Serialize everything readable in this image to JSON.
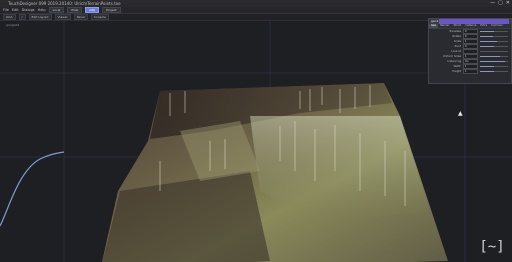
{
  "window": {
    "title": "TouchDesigner 099 2019.20140: Ulrich/TerrainPoints.toe",
    "controls": [
      "—",
      "▢",
      "✕"
    ]
  },
  "menubar": {
    "items": [
      "File",
      "Edit",
      "Dialogs",
      "Help"
    ],
    "buttons": [
      "Local",
      "Pixel",
      "Glbl",
      "Project"
    ],
    "active_button": "Glbl"
  },
  "toolbar2": {
    "items": [
      "OCA",
      "/",
      "Edit Layout",
      "Viewer",
      "Panel",
      "Console"
    ]
  },
  "viewport": {
    "label": "/project1"
  },
  "param_panel": {
    "title": "geo1",
    "tabs": [
      "Geo",
      "Render",
      "Xform",
      "Instance",
      "Extra",
      "Common"
    ],
    "active_tab": "Geo",
    "rows": [
      {
        "label": "Translate",
        "value": "0",
        "fill": 0.5
      },
      {
        "label": "Rotate",
        "value": "0",
        "fill": 0.45
      },
      {
        "label": "Scale",
        "value": "1",
        "fill": 0.6
      },
      {
        "label": "Pivot",
        "value": "0",
        "fill": 0.5
      },
      {
        "label": "Look At",
        "value": "",
        "fill": 0.0
      },
      {
        "label": "Uniform Scale",
        "value": "1",
        "fill": 0.7
      },
      {
        "label": "Instancing",
        "value": "On",
        "fill": 0.9
      },
      {
        "label": "Width",
        "value": "1",
        "fill": 0.5
      },
      {
        "label": "Height",
        "value": "1",
        "fill": 0.5
      }
    ]
  },
  "corner_logo": "[~]",
  "colors": {
    "background": "#1b1c20",
    "accent": "#6b56c8",
    "grid": "#3b4a66",
    "curve": "#7e9bd4"
  }
}
